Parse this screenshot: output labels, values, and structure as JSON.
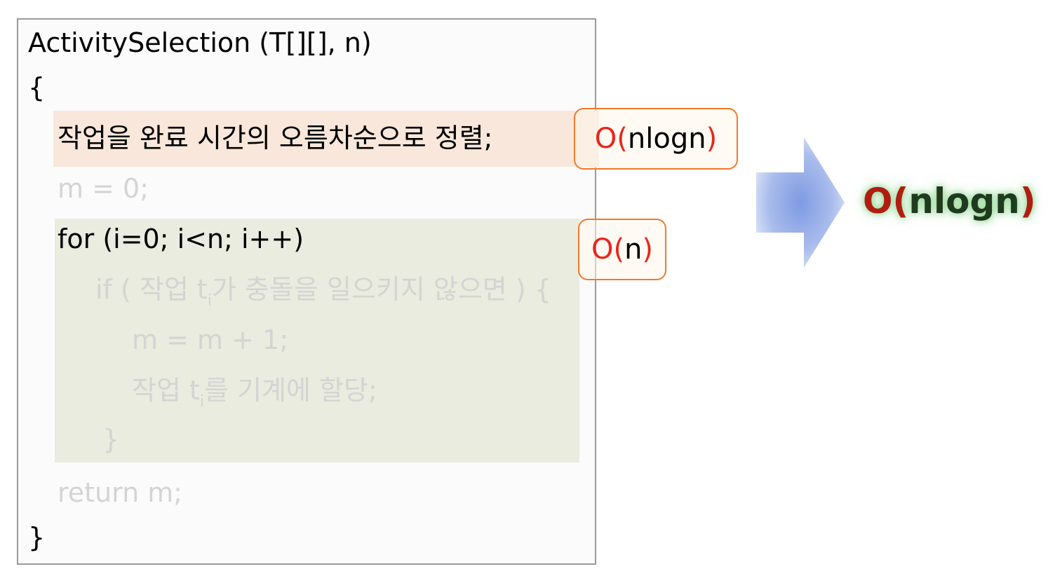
{
  "code": {
    "signature": "ActivitySelection (T[][], n)",
    "open_brace": "{",
    "sort_line": "작업을 완료 시간의 오름차순으로 정렬;",
    "init_line": "m = 0;",
    "for_line": "for (i=0; i<n; i++)",
    "if_line_a": "if ( 작업 t",
    "if_sub": "i",
    "if_line_b": "가 충돌을 일으키지 않으면 ) {",
    "increment_line": "m = m + 1;",
    "assign_line_a": "작업 t",
    "assign_sub": "i",
    "assign_line_b": "를 기계에 할당;",
    "inner_close_brace": "}",
    "return_line": "return m;",
    "close_brace": "}"
  },
  "badges": {
    "sort": {
      "open": "O(",
      "inner": "nlogn",
      "close": ")"
    },
    "loop": {
      "open": "O(",
      "inner": "n",
      "close": ")"
    }
  },
  "result": {
    "open": "O(",
    "inner": "nlogn",
    "close": ")"
  },
  "colors": {
    "sort_highlight": "#f8e7da",
    "loop_highlight": "#e9ecde",
    "badge_border": "#f07a2a",
    "paren_red": "#e8261a",
    "result_glow": "#7fd37f",
    "arrow_blue": "#8fa9e6"
  }
}
